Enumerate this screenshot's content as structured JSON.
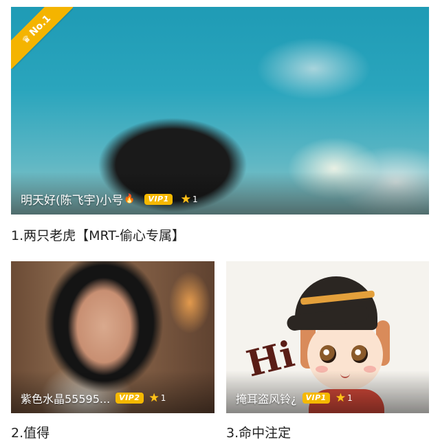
{
  "ranking": [
    {
      "rank_badge": "No.1",
      "username": "明天好(陈飞宇)小号",
      "vip_level": "VIP1",
      "stars": "1",
      "title": "1.两只老虎【MRT-偷心专属】"
    },
    {
      "username": "紫色水晶55595...",
      "vip_level": "VIP2",
      "stars": "1",
      "title": "2.值得"
    },
    {
      "username": "掩耳盗风铃¿",
      "vip_level": "VIP1",
      "stars": "1",
      "title": "3.命中注定"
    }
  ],
  "illustration_text": "Hi",
  "colors": {
    "accent": "#f4b400",
    "vip_badge": "#f5b800",
    "star": "#ffc21a",
    "title_text": "#222222"
  },
  "icons": [
    "crown-icon",
    "fire-icon",
    "star-icon"
  ]
}
